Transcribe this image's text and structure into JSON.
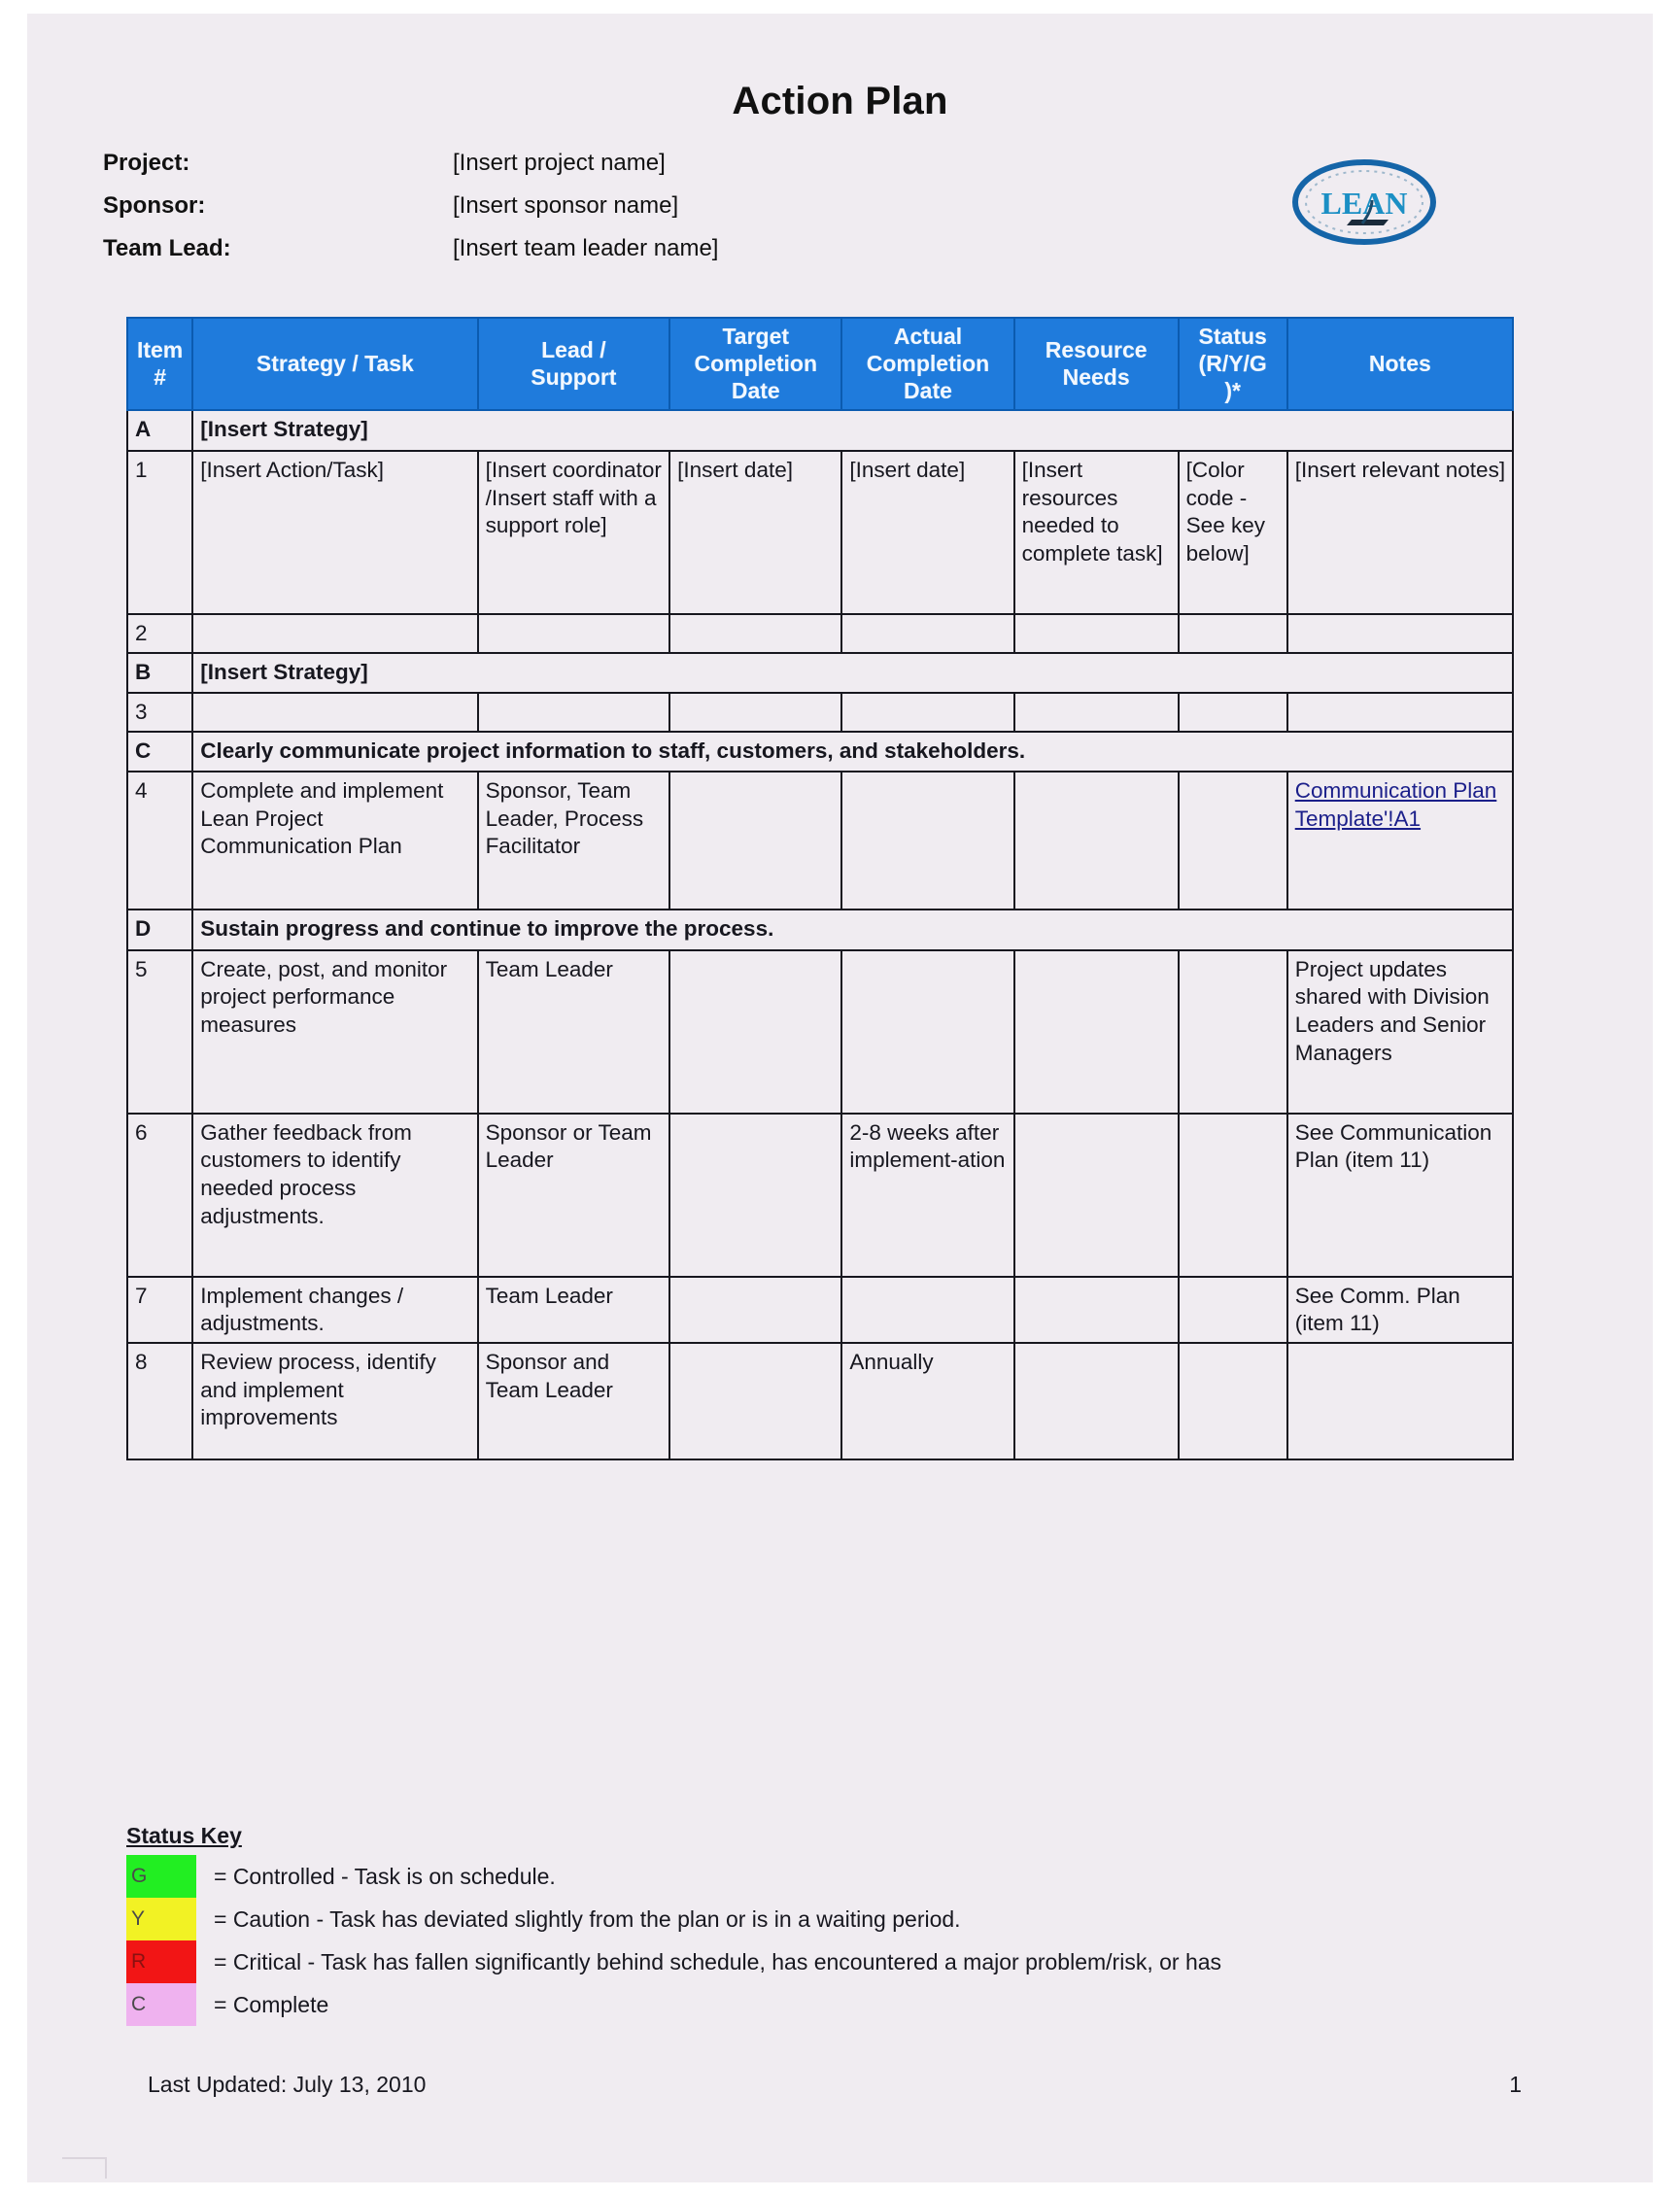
{
  "document": {
    "title": "Action Plan",
    "logo_text": "LEAN"
  },
  "meta": [
    {
      "label": "Project:",
      "value": "[Insert project name]"
    },
    {
      "label": "Sponsor:",
      "value": "[Insert sponsor name]"
    },
    {
      "label": "Team Lead:",
      "value": "[Insert team leader name]"
    }
  ],
  "table": {
    "headers": [
      "Item #",
      "Strategy / Task",
      "Lead / Support",
      "Target Completion Date",
      "Actual Completion Date",
      "Resource Needs",
      "Status (R/Y/G )*",
      "Notes"
    ],
    "headers_multiline": [
      [
        "Item",
        "#"
      ],
      [
        "Strategy / Task"
      ],
      [
        "Lead /",
        "Support"
      ],
      [
        "Target",
        "Completion",
        "Date"
      ],
      [
        "Actual",
        "Completion",
        "Date"
      ],
      [
        "Resource",
        "Needs"
      ],
      [
        "Status",
        "(R/Y/G",
        ")*"
      ],
      [
        "Notes"
      ]
    ],
    "rows": [
      {
        "kind": "section",
        "id": "A",
        "text": "[Insert Strategy]"
      },
      {
        "kind": "item",
        "id": "1",
        "task": "[Insert Action/Task]",
        "lead": "[Insert coordinator /Insert staff with a support role]",
        "target": "[Insert date]",
        "actual": "[Insert date]",
        "resources": "[Insert resources needed to complete task]",
        "status": "[Color code - See key below]",
        "notes": "[Insert relevant notes]"
      },
      {
        "kind": "item",
        "id": "2",
        "task": "",
        "lead": "",
        "target": "",
        "actual": "",
        "resources": "",
        "status": "",
        "notes": ""
      },
      {
        "kind": "section",
        "id": "B",
        "text": "[Insert Strategy]"
      },
      {
        "kind": "item",
        "id": "3",
        "task": "",
        "lead": "",
        "target": "",
        "actual": "",
        "resources": "",
        "status": "",
        "notes": ""
      },
      {
        "kind": "section",
        "id": "C",
        "text": "Clearly communicate project information to staff, customers, and stakeholders."
      },
      {
        "kind": "item",
        "id": "4",
        "task": "Complete and implement Lean Project Communication Plan",
        "lead": "Sponsor, Team Leader, Process Facilitator",
        "target": "",
        "actual": "",
        "resources": "",
        "status": "",
        "notes_link": "Communication Plan Template'!A1"
      },
      {
        "kind": "section",
        "id": "D",
        "text": "Sustain progress and continue to improve the process."
      },
      {
        "kind": "item",
        "id": "5",
        "task": "Create, post, and monitor project performance measures",
        "lead": "Team Leader",
        "target": "",
        "actual": "",
        "resources": "",
        "status": "",
        "notes": "Project updates shared with Division Leaders and Senior Managers"
      },
      {
        "kind": "item",
        "id": "6",
        "task": "Gather feedback from customers to identify needed process adjustments.",
        "lead": "Sponsor or Team Leader",
        "target": "",
        "actual": "2-8 weeks after implement-ation",
        "resources": "",
        "status": "",
        "notes": "See Communication Plan (item 11)"
      },
      {
        "kind": "item",
        "id": "7",
        "task": "Implement changes / adjustments.",
        "lead": "Team Leader",
        "target": "",
        "actual": "",
        "resources": "",
        "status": "",
        "notes": "See Comm. Plan (item 11)"
      },
      {
        "kind": "item",
        "id": "8",
        "task": "Review process, identify and implement improvements",
        "lead": "Sponsor and Team Leader",
        "target": "",
        "actual": "Annually",
        "resources": "",
        "status": "",
        "notes": ""
      }
    ]
  },
  "status_key": {
    "title": "Status Key",
    "entries": [
      {
        "code": "G",
        "color": "#22ee22",
        "description": "= Controlled - Task is on schedule."
      },
      {
        "code": "Y",
        "color": "#f2f224",
        "description": "= Caution - Task has deviated slightly from the plan or is in a waiting period."
      },
      {
        "code": "R",
        "color": "#f21515",
        "description": "= Critical - Task has fallen significantly behind schedule, has encountered a major problem/risk, or has"
      },
      {
        "code": "C",
        "color": "#efb2ef",
        "description": "= Complete"
      }
    ]
  },
  "footer": {
    "last_updated": "Last Updated: July 13, 2010",
    "page_number": "1"
  },
  "colors": {
    "header_blue": "#1f7bdc",
    "page_background": "#f0ecf1",
    "link": "#1b1f8a",
    "logo_blue": "#1565a8"
  }
}
